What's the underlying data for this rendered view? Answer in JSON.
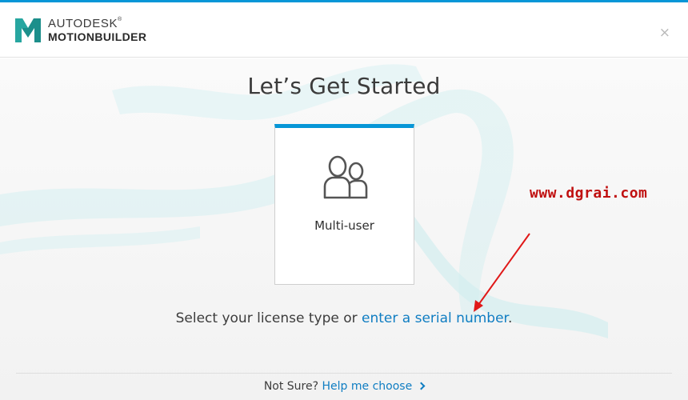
{
  "colors": {
    "accent": "#0696d7",
    "link": "#0f7dc2",
    "annotation": "#c01010",
    "logo": "#1c8f8b"
  },
  "header": {
    "logo_icon": "motionbuilder-m-logo",
    "brand_line1": "AUTODESK",
    "brand_registered": "®",
    "brand_line2": "MOTIONBUILDER",
    "close_label": "×",
    "close_icon": "close-icon"
  },
  "main": {
    "title": "Let’s Get Started",
    "options": [
      {
        "label": "Multi-user",
        "icon": "multi-user-icon",
        "selected": true
      }
    ],
    "prompt": {
      "text": "Select your license type or ",
      "link": "enter a serial number",
      "suffix": "."
    },
    "watermark": "www.dgrai.com",
    "annotation_icon": "arrow-icon"
  },
  "footer": {
    "question": "Not Sure?",
    "link": "Help me choose",
    "icon": "chevron-right-icon"
  }
}
